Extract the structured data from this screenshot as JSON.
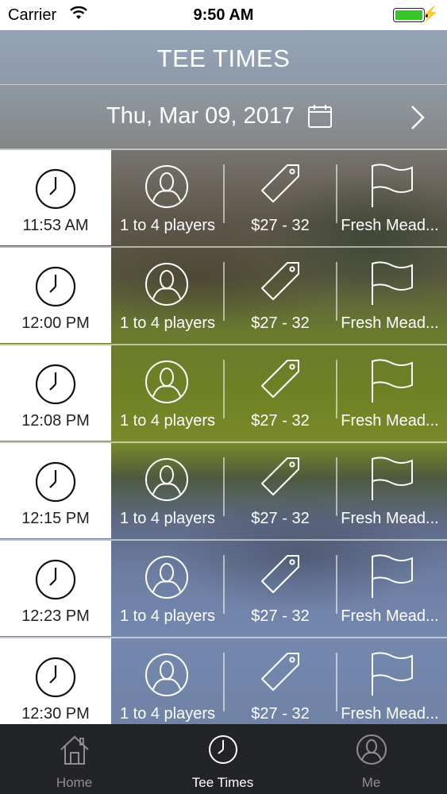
{
  "status_bar": {
    "carrier": "Carrier",
    "time": "9:50 AM"
  },
  "header": {
    "title": "TEE TIMES"
  },
  "date_bar": {
    "date": "Thu, Mar 09, 2017",
    "calendar_icon": "calendar-icon",
    "next_icon": "chevron-right-icon"
  },
  "tee_times": [
    {
      "time": "11:53 AM",
      "players": "1 to 4 players",
      "price": "$27 - 32",
      "course": "Fresh Mead..."
    },
    {
      "time": "12:00 PM",
      "players": "1 to 4 players",
      "price": "$27 - 32",
      "course": "Fresh Mead..."
    },
    {
      "time": "12:08 PM",
      "players": "1 to 4 players",
      "price": "$27 - 32",
      "course": "Fresh Mead..."
    },
    {
      "time": "12:15 PM",
      "players": "1 to 4 players",
      "price": "$27 - 32",
      "course": "Fresh Mead..."
    },
    {
      "time": "12:23 PM",
      "players": "1 to 4 players",
      "price": "$27 - 32",
      "course": "Fresh Mead..."
    },
    {
      "time": "12:30 PM",
      "players": "1 to 4 players",
      "price": "$27 - 32",
      "course": "Fresh Mead..."
    }
  ],
  "tab_bar": {
    "tabs": [
      {
        "label": "Home",
        "icon": "home-icon",
        "active": false
      },
      {
        "label": "Tee Times",
        "icon": "clock-icon",
        "active": true
      },
      {
        "label": "Me",
        "icon": "user-icon",
        "active": false
      }
    ]
  },
  "colors": {
    "battery": "#37c52b",
    "tab_bar": "#232427",
    "active_tab": "#ffffff",
    "inactive_tab": "#8e8e93"
  }
}
